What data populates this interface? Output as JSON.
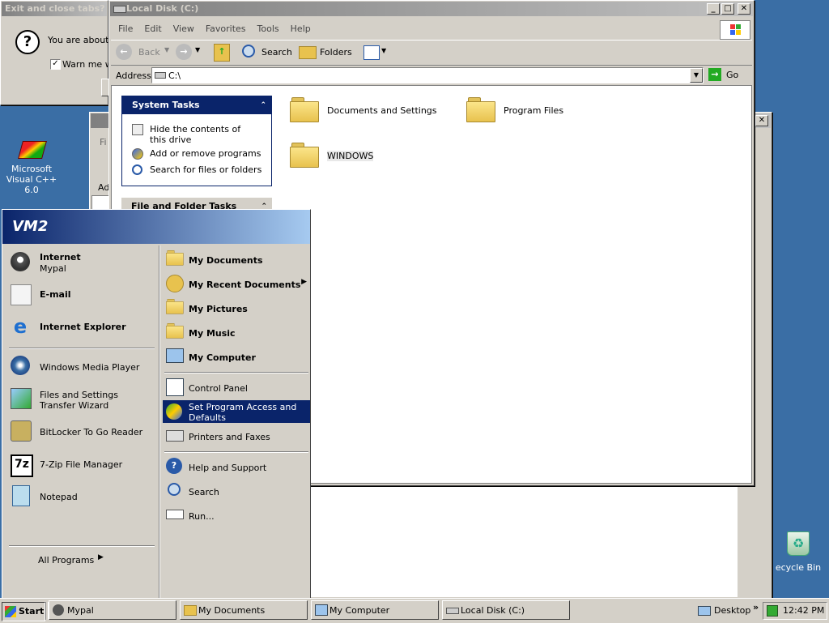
{
  "dialog": {
    "title": "Exit and close tabs?",
    "message": "You are about t",
    "checkbox_label": "Warn me wl"
  },
  "desktop_icons": [
    {
      "label": "Microsoft Visual C++ 6.0"
    },
    {
      "label": "ecycle Bin"
    }
  ],
  "explorer": {
    "title": "Local Disk (C:)",
    "menu": [
      "File",
      "Edit",
      "View",
      "Favorites",
      "Tools",
      "Help"
    ],
    "toolbar": {
      "back": "Back",
      "search": "Search",
      "folders": "Folders"
    },
    "address_label": "Address",
    "address_value": "C:\\",
    "go_label": "Go",
    "system_tasks": {
      "title": "System Tasks",
      "items": [
        "Hide the contents of this drive",
        "Add or remove programs",
        "Search for files or folders"
      ]
    },
    "file_tasks_title": "File and Folder Tasks",
    "folders": [
      "Documents and Settings",
      "Program Files",
      "WINDOWS"
    ]
  },
  "back_window": {
    "menu_fragment": "Fi",
    "address_fragment": "Ad"
  },
  "start_menu": {
    "user": "VM2",
    "pinned": [
      {
        "title": "Internet",
        "sub": "Mypal"
      },
      {
        "title": "E-mail",
        "sub": ""
      },
      {
        "title": "Internet Explorer",
        "sub": ""
      }
    ],
    "recent": [
      {
        "title": "Windows Media Player"
      },
      {
        "title": "Files and Settings Transfer Wizard"
      },
      {
        "title": "BitLocker To Go Reader"
      },
      {
        "title": "7-Zip File Manager"
      },
      {
        "title": "Notepad"
      }
    ],
    "all_programs": "All Programs",
    "right_top": [
      "My Documents",
      "My Recent Documents",
      "My Pictures",
      "My Music",
      "My Computer"
    ],
    "right_mid": [
      "Control Panel",
      "Set Program Access and Defaults",
      "Printers and Faxes"
    ],
    "right_bottom": [
      "Help and Support",
      "Search",
      "Run..."
    ]
  },
  "taskbar": {
    "start": "Start",
    "tasks": [
      "Mypal",
      "My Documents",
      "My Computer",
      "Local Disk (C:)"
    ],
    "desktop_label": "Desktop",
    "time": "12:42 PM"
  }
}
